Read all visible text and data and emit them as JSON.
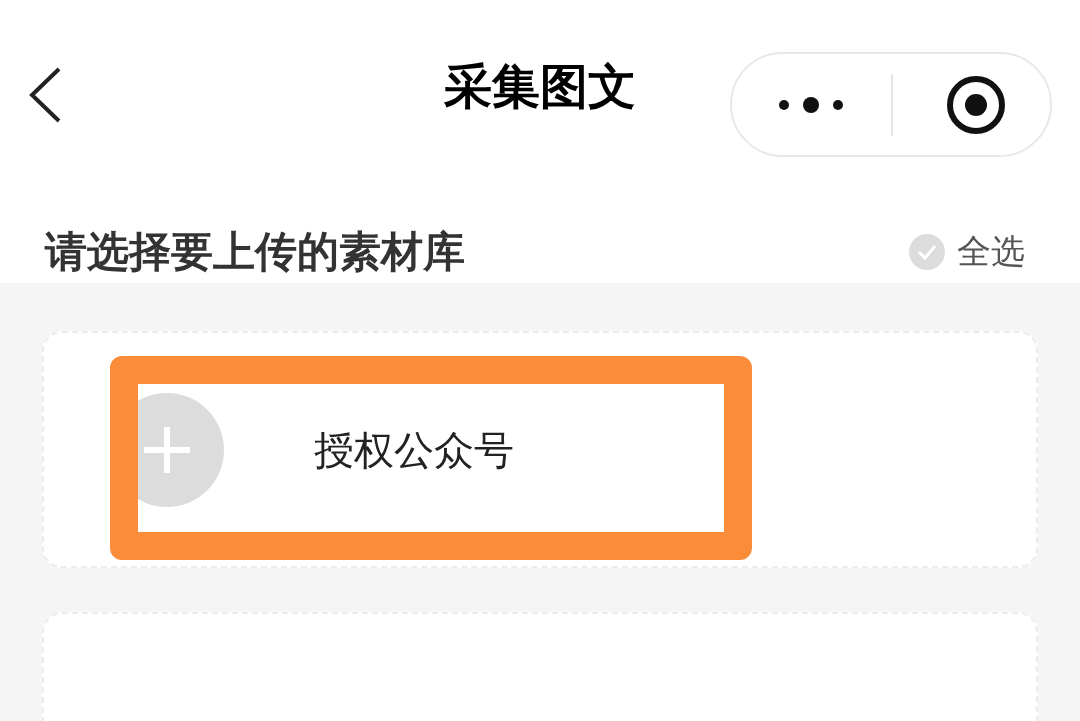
{
  "nav_bar": {
    "title": "采集图文"
  },
  "section": {
    "title": "请选择要上传的素材库",
    "select_all": {
      "label": "全选",
      "checked": false
    }
  },
  "authorize_card": {
    "label": "授权公众号",
    "highlighted": true
  }
}
